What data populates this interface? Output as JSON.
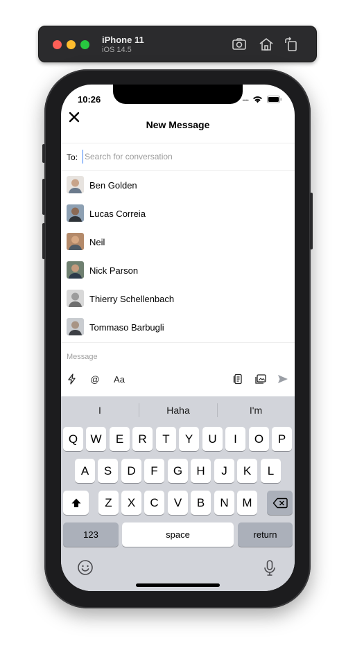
{
  "simulator": {
    "device_name": "iPhone 11",
    "os_version": "iOS 14.5",
    "icons": [
      "screenshot-icon",
      "home-icon",
      "rotate-icon"
    ]
  },
  "status_bar": {
    "time": "10:26"
  },
  "header": {
    "title": "New Message"
  },
  "recipient": {
    "label": "To:",
    "placeholder": "Search for conversation",
    "value": ""
  },
  "contacts": [
    {
      "name": "Ben Golden",
      "avatar_color": "#c8a48a"
    },
    {
      "name": "Lucas Correia",
      "avatar_color": "#4c5560"
    },
    {
      "name": "Neil",
      "avatar_color": "#a07d62"
    },
    {
      "name": "Nick Parson",
      "avatar_color": "#5a6a58"
    },
    {
      "name": "Thierry Schellenbach",
      "avatar_color": "#b9bcbf"
    },
    {
      "name": "Tommaso Barbugli",
      "avatar_color": "#9a9ea3"
    }
  ],
  "composer": {
    "placeholder": "Message",
    "tools": [
      "lightning-icon",
      "mention-icon",
      "text-format-icon",
      "file-icon",
      "image-icon",
      "send-icon"
    ],
    "format_label": "Aa",
    "mention_label": "@"
  },
  "keyboard": {
    "suggestions": [
      "I",
      "Haha",
      "I'm"
    ],
    "row1": [
      "Q",
      "W",
      "E",
      "R",
      "T",
      "Y",
      "U",
      "I",
      "O",
      "P"
    ],
    "row2": [
      "A",
      "S",
      "D",
      "F",
      "G",
      "H",
      "J",
      "K",
      "L"
    ],
    "row3": [
      "Z",
      "X",
      "C",
      "V",
      "B",
      "N",
      "M"
    ],
    "numbers_label": "123",
    "space_label": "space",
    "return_label": "return"
  },
  "colors": {
    "accent": "#3b82f6",
    "keyboard_bg": "#d2d4da",
    "send_icon": "#9a9ea5"
  }
}
